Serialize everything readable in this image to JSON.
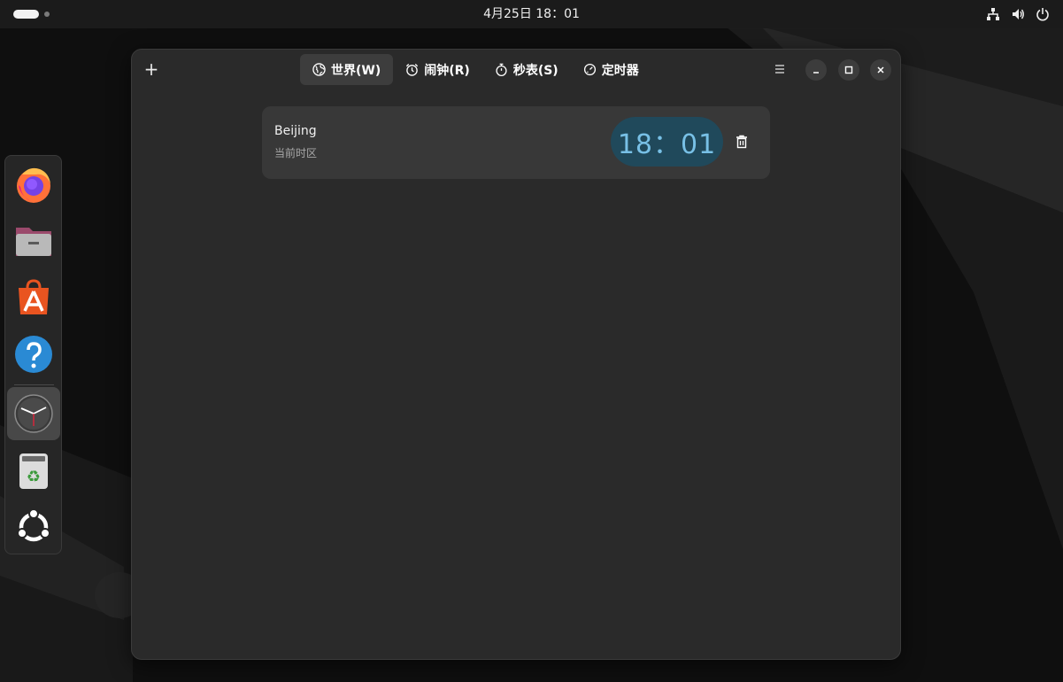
{
  "topbar": {
    "datetime": "4月25日  18：01",
    "icons": [
      "network-icon",
      "volume-icon",
      "power-icon"
    ]
  },
  "dock": {
    "apps": [
      "firefox",
      "files",
      "app-center",
      "help",
      "clocks",
      "trash",
      "ubuntu-apps"
    ],
    "active": "clocks"
  },
  "window": {
    "add_label": "+",
    "tabs": [
      {
        "label": "世界(W)",
        "icon": "globe-icon",
        "active": true
      },
      {
        "label": "闹钟(R)",
        "icon": "alarm-icon",
        "active": false
      },
      {
        "label": "秒表(S)",
        "icon": "stopwatch-icon",
        "active": false
      },
      {
        "label": "定时器",
        "icon": "timer-icon",
        "active": false
      }
    ],
    "world_clocks": [
      {
        "city": "Beijing",
        "subtitle": "当前时区",
        "time": "18：01"
      }
    ]
  },
  "colors": {
    "accent_time_bg": "#20495b",
    "accent_time_fg": "#78c0e6",
    "running_indicator": "#e95420"
  }
}
